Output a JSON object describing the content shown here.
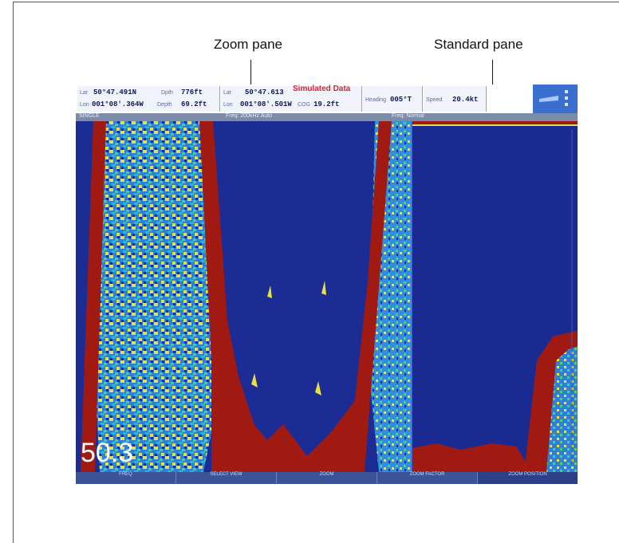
{
  "annotations": {
    "zoom_label": "Zoom pane",
    "standard_label": "Standard pane"
  },
  "display": {
    "overlay_text": "Simulated Data",
    "depth_readout": "50.3"
  },
  "colors": {
    "water": "#1c2c95",
    "bottom": "#a01a12",
    "returns_yellow": "#e8e040",
    "returns_cyan": "#30b0e0",
    "returns_green": "#4cd080"
  },
  "icons": {
    "down_arrow": "down-arrow-icon",
    "corner_widget": "boat-status-icon"
  }
}
